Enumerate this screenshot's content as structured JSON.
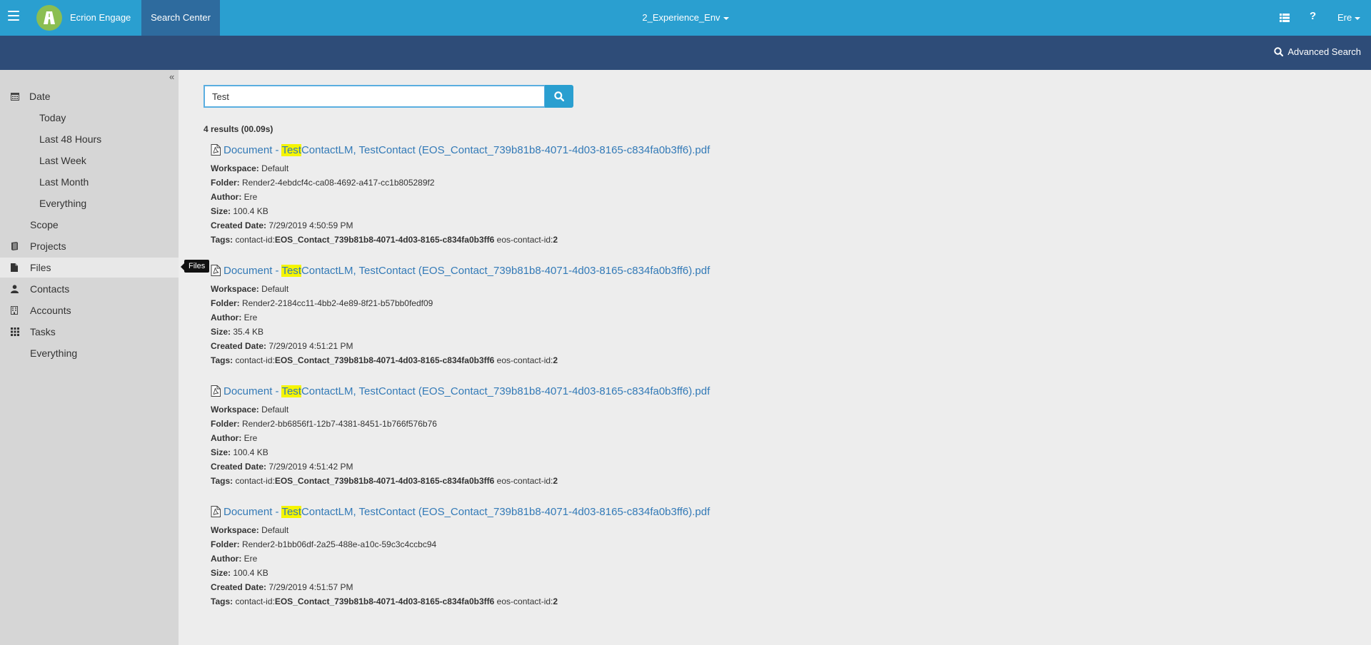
{
  "header": {
    "brand": "Ecrion Engage",
    "active_tab": "Search Center",
    "environment": "2_Experience_Env",
    "help": "?",
    "user": "Ere"
  },
  "subbar": {
    "advanced_search": "Advanced Search"
  },
  "sidebar": {
    "collapse": "«",
    "items": [
      {
        "label": "Date",
        "icon": "calendar-icon"
      },
      {
        "label": "Today"
      },
      {
        "label": "Last 48 Hours"
      },
      {
        "label": "Last Week"
      },
      {
        "label": "Last Month"
      },
      {
        "label": "Everything"
      },
      {
        "label": "Scope"
      },
      {
        "label": "Projects",
        "icon": "book-icon"
      },
      {
        "label": "Files",
        "icon": "file-icon"
      },
      {
        "label": "Contacts",
        "icon": "user-icon"
      },
      {
        "label": "Accounts",
        "icon": "building-icon"
      },
      {
        "label": "Tasks",
        "icon": "grid-icon"
      },
      {
        "label": "Everything"
      }
    ],
    "tooltip": "Files"
  },
  "search": {
    "value": "Test"
  },
  "results_summary": "4 results (00.09s)",
  "labels": {
    "workspace": "Workspace:",
    "folder": "Folder:",
    "author": "Author:",
    "size": "Size:",
    "created": "Created Date:",
    "tags": "Tags:"
  },
  "results": [
    {
      "title_prefix": "Document - ",
      "title_highlight": "Test",
      "title_suffix": "ContactLM, TestContact (EOS_Contact_739b81b8-4071-4d03-8165-c834fa0b3ff6).pdf",
      "workspace": "Default",
      "folder": "Render2-4ebdcf4c-ca08-4692-a417-cc1b805289f2",
      "author": "Ere",
      "size": "100.4 KB",
      "created": "7/29/2019 4:50:59 PM",
      "tag_key1": "contact-id:",
      "tag_val1": "EOS_Contact_739b81b8-4071-4d03-8165-c834fa0b3ff6",
      "tag_key2": "eos-contact-id:",
      "tag_val2": "2"
    },
    {
      "title_prefix": "Document - ",
      "title_highlight": "Test",
      "title_suffix": "ContactLM, TestContact (EOS_Contact_739b81b8-4071-4d03-8165-c834fa0b3ff6).pdf",
      "workspace": "Default",
      "folder": "Render2-2184cc11-4bb2-4e89-8f21-b57bb0fedf09",
      "author": "Ere",
      "size": "35.4 KB",
      "created": "7/29/2019 4:51:21 PM",
      "tag_key1": "contact-id:",
      "tag_val1": "EOS_Contact_739b81b8-4071-4d03-8165-c834fa0b3ff6",
      "tag_key2": "eos-contact-id:",
      "tag_val2": "2"
    },
    {
      "title_prefix": "Document - ",
      "title_highlight": "Test",
      "title_suffix": "ContactLM, TestContact (EOS_Contact_739b81b8-4071-4d03-8165-c834fa0b3ff6).pdf",
      "workspace": "Default",
      "folder": "Render2-bb6856f1-12b7-4381-8451-1b766f576b76",
      "author": "Ere",
      "size": "100.4 KB",
      "created": "7/29/2019 4:51:42 PM",
      "tag_key1": "contact-id:",
      "tag_val1": "EOS_Contact_739b81b8-4071-4d03-8165-c834fa0b3ff6",
      "tag_key2": "eos-contact-id:",
      "tag_val2": "2"
    },
    {
      "title_prefix": "Document - ",
      "title_highlight": "Test",
      "title_suffix": "ContactLM, TestContact (EOS_Contact_739b81b8-4071-4d03-8165-c834fa0b3ff6).pdf",
      "workspace": "Default",
      "folder": "Render2-b1bb06df-2a25-488e-a10c-59c3c4ccbc94",
      "author": "Ere",
      "size": "100.4 KB",
      "created": "7/29/2019 4:51:57 PM",
      "tag_key1": "contact-id:",
      "tag_val1": "EOS_Contact_739b81b8-4071-4d03-8165-c834fa0b3ff6",
      "tag_key2": "eos-contact-id:",
      "tag_val2": "2"
    }
  ],
  "colors": {
    "topbar": "#2a9fd0",
    "subbar": "#2e4c78",
    "active_tab": "#2e6b9e",
    "link": "#337ab7",
    "highlight": "#f5f500",
    "logo": "#8bbe52"
  }
}
